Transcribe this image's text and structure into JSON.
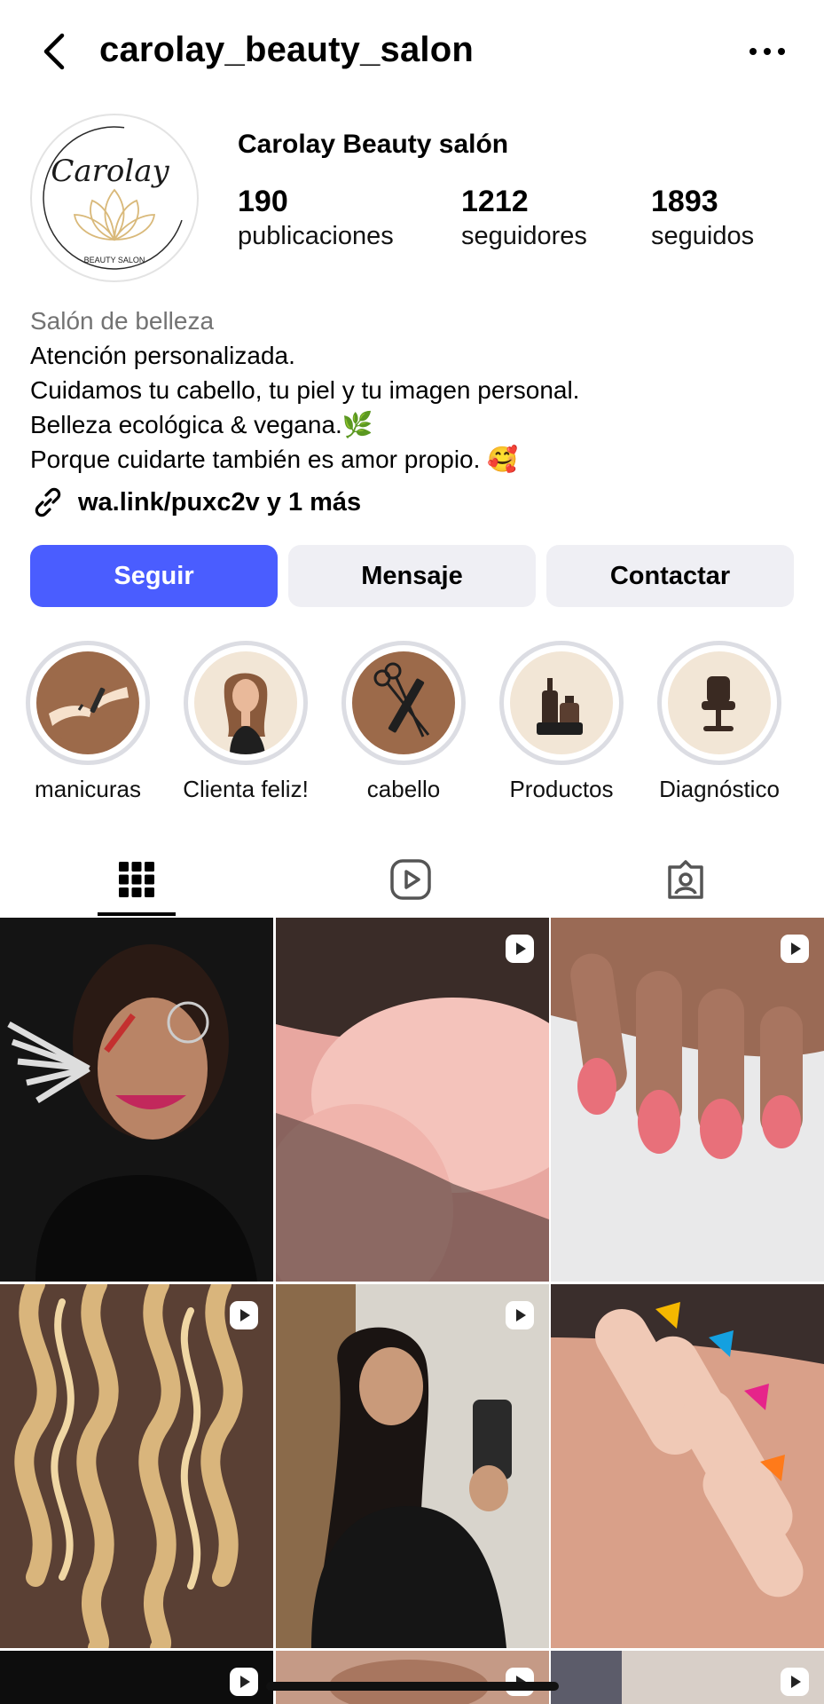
{
  "header": {
    "username": "carolay_beauty_salon",
    "back_icon": "chevron-left-icon",
    "more_icon": "more-horizontal-icon"
  },
  "profile": {
    "avatar_logo_script": "Carolay",
    "avatar_logo_sub": "BEAUTY SALON",
    "display_name": "Carolay Beauty salón",
    "stats": [
      {
        "value": "190",
        "label": "publicaciones"
      },
      {
        "value": "1212",
        "label": "seguidores"
      },
      {
        "value": "1893",
        "label": "seguidos"
      }
    ]
  },
  "bio": {
    "category": "Salón de belleza",
    "lines": [
      "Atención personalizada.",
      "Cuidamos tu cabello, tu piel y tu imagen personal.",
      "Belleza ecológica & vegana.🌿",
      "Porque cuidarte también es amor propio. 🥰"
    ],
    "link": "wa.link/puxc2v y 1 más"
  },
  "actions": {
    "follow": "Seguir",
    "message": "Mensaje",
    "contact": "Contactar"
  },
  "highlights": [
    {
      "label": "manicuras",
      "icon": "manicure-icon"
    },
    {
      "label": "Clienta feliz!",
      "icon": "woman-portrait-icon"
    },
    {
      "label": "cabello",
      "icon": "scissors-comb-icon"
    },
    {
      "label": "Productos",
      "icon": "product-bottles-icon"
    },
    {
      "label": "Diagnóstico",
      "icon": "salon-chair-icon"
    }
  ],
  "tabs": [
    {
      "name": "grid",
      "icon": "grid-icon",
      "active": true
    },
    {
      "name": "reels",
      "icon": "reels-icon",
      "active": false
    },
    {
      "name": "tagged",
      "icon": "tagged-icon",
      "active": false
    }
  ],
  "colors": {
    "accent": "#4a5dff",
    "secondary_button": "#efeff4",
    "muted_text": "#737373",
    "highlight_ring": "#dcdde3"
  }
}
